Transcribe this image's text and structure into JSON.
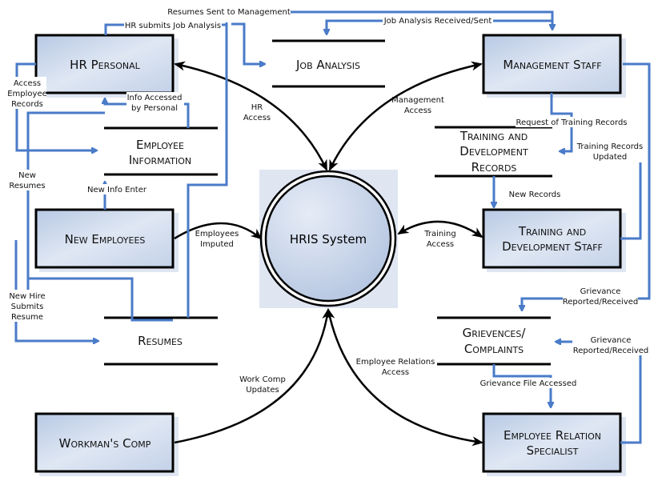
{
  "entities": {
    "hr_personal": "HR Personal",
    "management_staff": "Management Staff",
    "new_employees": "New Employees",
    "training_staff_l1": "Training and",
    "training_staff_l2": "Development Staff",
    "workmans_comp": "Workman's Comp",
    "employee_relation_l1": "Employee Relation",
    "employee_relation_l2": "Specialist"
  },
  "process": "HRIS System",
  "stores": {
    "job_analysis": "Job Analysis",
    "employee_info_l1": "Employee",
    "employee_info_l2": "Information",
    "training_records_l1": "Training and",
    "training_records_l2": "Development",
    "training_records_l3": "Records",
    "resumes": "Resumes",
    "grievances_l1": "Grievences/",
    "grievances_l2": "Complaints"
  },
  "flows": {
    "resumes_sent": "Resumes Sent to Management",
    "hr_submits": "HR submits Job Analysis",
    "job_analysis_received": "Job Analysis Received/Sent",
    "access_records_l1": "Access",
    "access_records_l2": "Employee",
    "access_records_l3": "Records",
    "info_accessed_l1": "Info Accessed",
    "info_accessed_l2": "by Personal",
    "hr_access_l1": "HR",
    "hr_access_l2": "Access",
    "mgmt_access_l1": "Management",
    "mgmt_access_l2": "Access",
    "request_training": "Request of Training Records",
    "training_updated_l1": "Training Records",
    "training_updated_l2": "Updated",
    "new_resumes_l1": "New",
    "new_resumes_l2": "Resumes",
    "new_info_enter": "New Info Enter",
    "new_records": "New Records",
    "employees_imputed_l1": "Employees",
    "employees_imputed_l2": "Imputed",
    "training_access_l1": "Training",
    "training_access_l2": "Access",
    "new_hire_l1": "New Hire",
    "new_hire_l2": "Submits",
    "new_hire_l3": "Resume",
    "grievance_top_l1": "Grievance",
    "grievance_top_l2": "Reported/Received",
    "grievance_right_l1": "Grievance",
    "grievance_right_l2": "Reported/Received",
    "er_access_l1": "Employee Relations",
    "er_access_l2": "Access",
    "grievance_file": "Grievance File Accessed",
    "work_comp_l1": "Work Comp",
    "work_comp_l2": "Updates"
  },
  "colors": {
    "flow": "#4a7bc8",
    "box_fill": "#c9d6ea"
  }
}
